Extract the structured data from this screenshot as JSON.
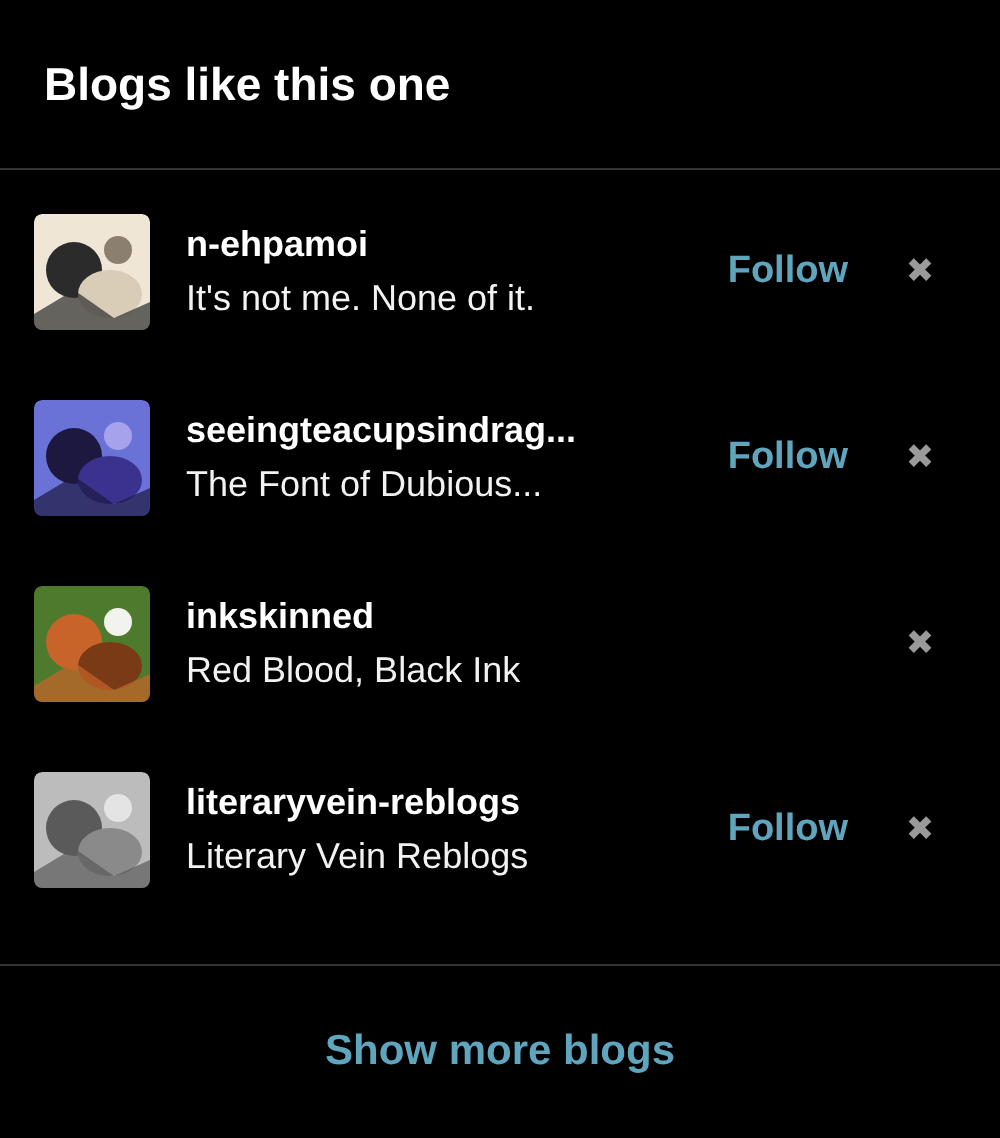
{
  "title": "Blogs like this one",
  "blogs": [
    {
      "name": "n-ehpamoi",
      "description": "It's not me. None of it.",
      "follow": "Follow",
      "dismiss": "✖"
    },
    {
      "name": "seeingteacupsindrag...",
      "description": "The Font of Dubious...",
      "follow": "Follow",
      "dismiss": "✖"
    },
    {
      "name": "inkskinned",
      "description": "Red Blood, Black Ink",
      "dismiss": "✖"
    },
    {
      "name": "literaryvein-reblogs",
      "description": "Literary Vein Reblogs",
      "follow": "Follow",
      "dismiss": "✖"
    }
  ],
  "show_more": "Show more blogs"
}
